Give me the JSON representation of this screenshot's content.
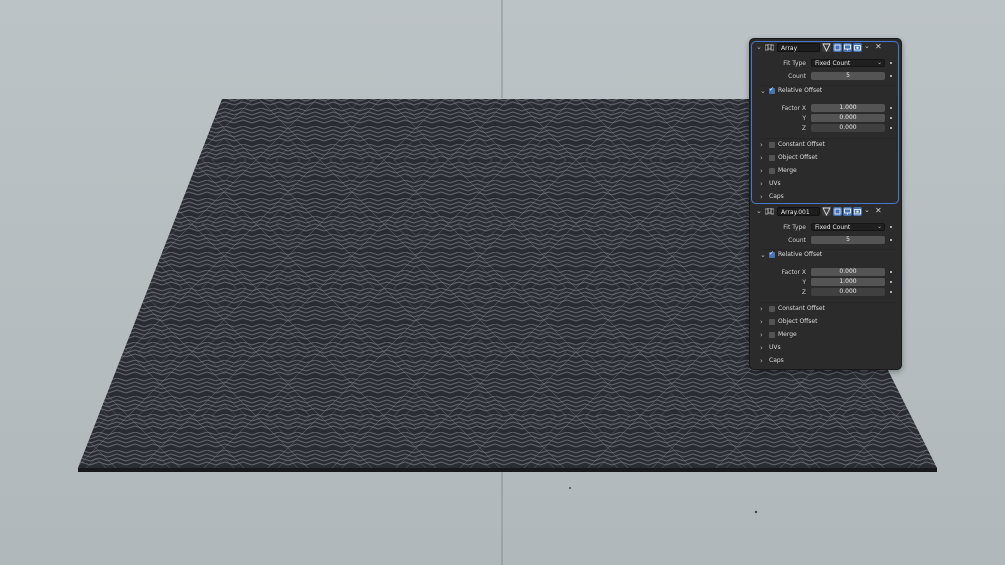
{
  "modifiers": [
    {
      "name": "Array",
      "fit_type_label": "Fit Type",
      "fit_type_value": "Fixed Count",
      "count_label": "Count",
      "count_value": "5",
      "relative_offset_label": "Relative Offset",
      "relative_offset_enabled": true,
      "factor_x_label": "Factor X",
      "factor_x": "1.000",
      "y_label": "Y",
      "factor_y": "0.000",
      "z_label": "Z",
      "factor_z": "0.000",
      "constant_offset_label": "Constant Offset",
      "object_offset_label": "Object Offset",
      "merge_label": "Merge",
      "uvs_label": "UVs",
      "caps_label": "Caps"
    },
    {
      "name": "Array.001",
      "fit_type_label": "Fit Type",
      "fit_type_value": "Fixed Count",
      "count_label": "Count",
      "count_value": "5",
      "relative_offset_label": "Relative Offset",
      "relative_offset_enabled": true,
      "factor_x_label": "Factor X",
      "factor_x": "0.000",
      "y_label": "Y",
      "factor_y": "1.000",
      "z_label": "Z",
      "factor_z": "0.000",
      "constant_offset_label": "Constant Offset",
      "object_offset_label": "Object Offset",
      "merge_label": "Merge",
      "uvs_label": "UVs",
      "caps_label": "Caps"
    }
  ],
  "icons": {
    "collapse": "chevron-down-icon",
    "expand": "chevron-right-icon",
    "modifier": "wrench-icon",
    "edit_mode": "edit-mode-icon",
    "on_cage": "on-cage-icon",
    "viewport": "monitor-icon",
    "render": "camera-icon",
    "menu": "dropdown-icon",
    "delete": "close-icon"
  },
  "colors": {
    "background": "#b9c0c3",
    "panel": "#2b2b2b",
    "accent": "#4772b3",
    "mesh": "#2a2d32"
  }
}
